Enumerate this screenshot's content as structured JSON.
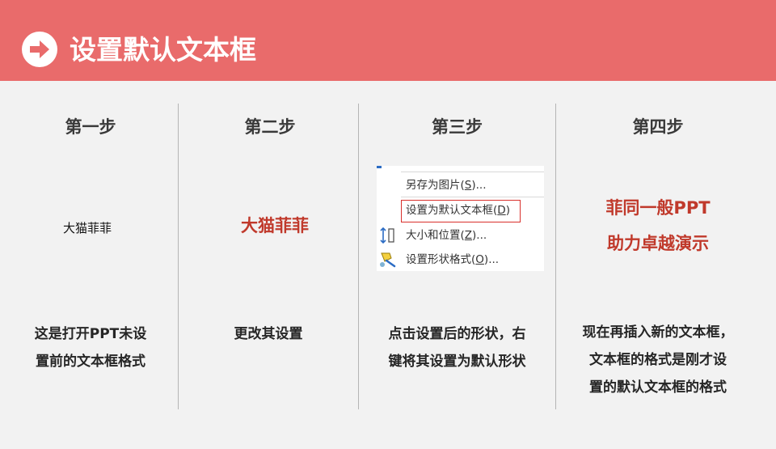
{
  "header": {
    "title": "设置默认文本框",
    "icon": "arrow-right-circle-icon",
    "bg_color": "#e96b6b"
  },
  "steps": [
    {
      "title": "第一步",
      "sample_text": "大猫菲菲",
      "description_lines": [
        "这是打开PPT未设",
        "置前的文本框格式"
      ]
    },
    {
      "title": "第二步",
      "sample_text": "大猫菲菲",
      "description_lines": [
        "更改其设置"
      ]
    },
    {
      "title": "第三步",
      "context_menu": {
        "items": [
          {
            "label": "另存为图片(",
            "key": "S",
            "suffix": ")..."
          },
          {
            "label": "设置为默认文本框(",
            "key": "D",
            "suffix": ")"
          },
          {
            "label": "大小和位置(",
            "key": "Z",
            "suffix": ")..."
          },
          {
            "label": "设置形状格式(",
            "key": "O",
            "suffix": ")..."
          }
        ],
        "highlight_color": "#d9302c"
      },
      "description_lines": [
        "点击设置后的形状，右",
        "键将其设置为默认形状"
      ]
    },
    {
      "title": "第四步",
      "sample_lines": [
        "菲同一般PPT",
        "助力卓越演示"
      ],
      "description_lines": [
        "现在再插入新的文本框，",
        "文本框的格式是刚才设",
        "置的默认文本框的格式"
      ]
    }
  ],
  "colors": {
    "accent_red": "#c0392b",
    "divider": "#b5b5b5",
    "background": "#f2f2f2"
  }
}
